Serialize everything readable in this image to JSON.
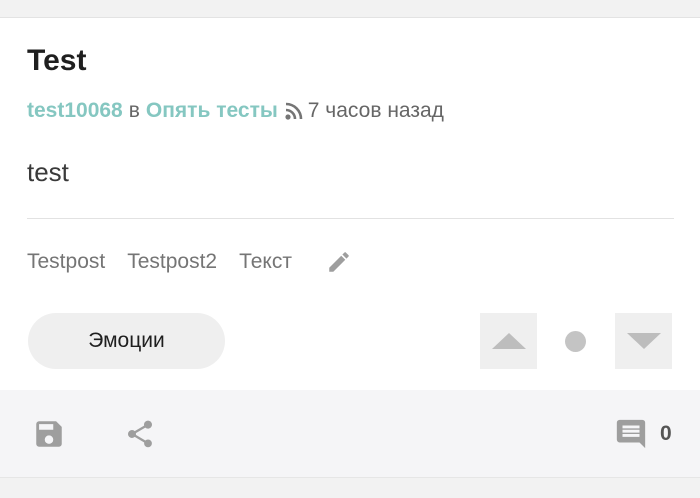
{
  "post": {
    "title": "Test",
    "author": "test10068",
    "in_word": "в",
    "community": "Опять тесты",
    "time_ago": "7 часов назад",
    "body": "test"
  },
  "tags": [
    "Testpost",
    "Testpost2",
    "Текст"
  ],
  "actions": {
    "emotions_label": "Эмоции",
    "comment_count": "0"
  },
  "icons": {
    "feed": "rss-icon",
    "edit": "pencil-icon",
    "save": "floppy-disk-icon",
    "share": "share-icon",
    "comments": "comment-icon",
    "vote_up": "triangle-up-icon",
    "vote_down": "triangle-down-icon"
  },
  "colors": {
    "accent_link": "#85c7c1",
    "icon_gray": "#9e9e9e",
    "button_bg": "#efefef",
    "footer_bg": "#f5f5f7"
  }
}
